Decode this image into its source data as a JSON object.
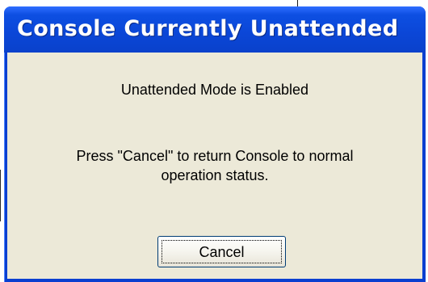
{
  "dialog": {
    "title": "Console Currently Unattended",
    "message_primary": "Unattended Mode is Enabled",
    "message_secondary_line1": "Press \"Cancel\" to return Console to normal",
    "message_secondary_line2": "operation status.",
    "cancel_label": "Cancel"
  },
  "theme": {
    "titlebar_color": "#0a41cb",
    "client_background": "#ece9d8",
    "button_border": "#003c74"
  }
}
